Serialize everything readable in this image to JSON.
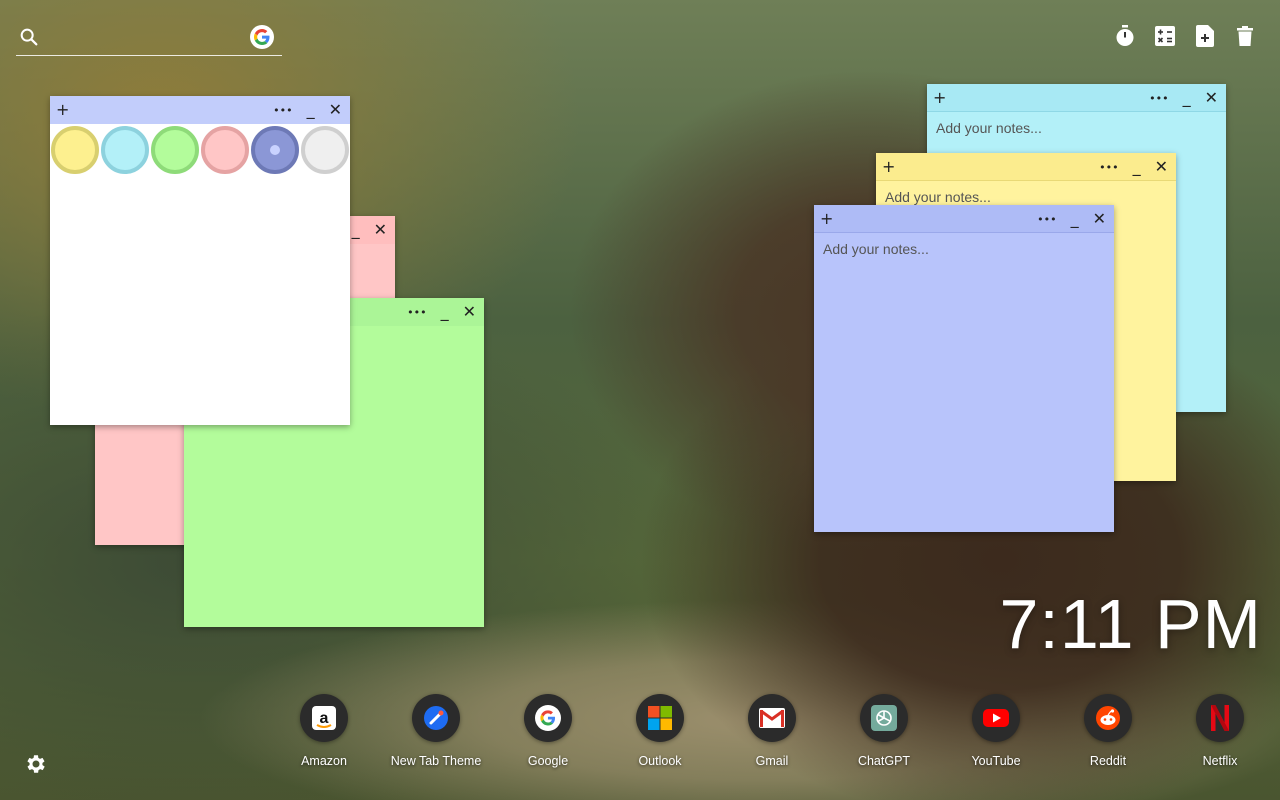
{
  "search": {
    "placeholder": ""
  },
  "tools": [
    {
      "icon": "timer-icon"
    },
    {
      "icon": "calculator-icon"
    },
    {
      "icon": "add-note-icon"
    },
    {
      "icon": "trash-icon"
    }
  ],
  "note_controls": {
    "add": "+",
    "more": "•••",
    "minimize": "_",
    "close": "✕"
  },
  "notes": {
    "cyan": {
      "placeholder": "Add your notes...",
      "color": "#b3f0f8"
    },
    "yellow": {
      "placeholder": "Add your notes...",
      "color": "#fff39e"
    },
    "blue": {
      "placeholder": "Add your notes...",
      "color": "#b8c4fb"
    },
    "pink": {
      "color": "#ffc6c6"
    },
    "green": {
      "color": "#b3fc9b"
    },
    "white": {
      "color": "#ffffff"
    }
  },
  "color_picker": {
    "swatches": [
      {
        "fill": "#fdf08f",
        "ring": "#d8cf6f"
      },
      {
        "fill": "#b3f0f8",
        "ring": "#8dd2de"
      },
      {
        "fill": "#b3fc9b",
        "ring": "#8edb79"
      },
      {
        "fill": "#ffc6c6",
        "ring": "#e5a3a3"
      },
      {
        "fill": "#8b97d6",
        "ring": "#6d79b6",
        "selected": true
      },
      {
        "fill": "#efefef",
        "ring": "#cfcfcf"
      }
    ]
  },
  "clock": {
    "time": "7:11 PM"
  },
  "dock": [
    {
      "label": "Amazon",
      "icon": "amazon-icon"
    },
    {
      "label": "New Tab Theme",
      "icon": "new-tab-theme-icon"
    },
    {
      "label": "Google",
      "icon": "google-icon"
    },
    {
      "label": "Outlook",
      "icon": "outlook-icon"
    },
    {
      "label": "Gmail",
      "icon": "gmail-icon"
    },
    {
      "label": "ChatGPT",
      "icon": "chatgpt-icon"
    },
    {
      "label": "YouTube",
      "icon": "youtube-icon"
    },
    {
      "label": "Reddit",
      "icon": "reddit-icon"
    },
    {
      "label": "Netflix",
      "icon": "netflix-icon"
    }
  ],
  "settings": {
    "icon": "settings-icon"
  }
}
